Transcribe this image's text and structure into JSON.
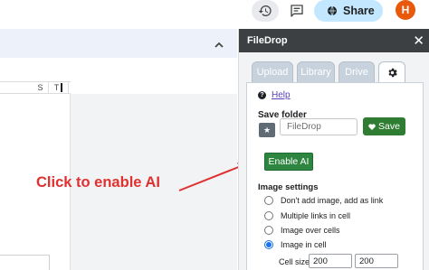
{
  "toolbar": {
    "history_icon": "history-icon",
    "comment_icon": "comment-icon",
    "share_label": "Share",
    "share_icon": "globe-icon",
    "avatar_letter": "H"
  },
  "sheet": {
    "columns": [
      "S",
      "T"
    ]
  },
  "annotation": {
    "text": "Click to enable AI",
    "color": "#e03131"
  },
  "panel": {
    "title": "FileDrop",
    "tabs": [
      {
        "label": "Upload"
      },
      {
        "label": "Library"
      },
      {
        "label": "Drive"
      },
      {
        "label": "",
        "icon": "gear-icon"
      }
    ],
    "help_label": "Help",
    "save_folder_label": "Save folder",
    "folder_placeholder": "FileDrop",
    "save_label": "Save",
    "enable_ai_label": "Enable AI",
    "image_settings_label": "Image settings",
    "image_options": [
      {
        "label": "Don't add image, add as link",
        "checked": false
      },
      {
        "label": "Multiple links in cell",
        "checked": false
      },
      {
        "label": "Image over cells",
        "checked": false
      },
      {
        "label": "Image in cell",
        "checked": true
      }
    ],
    "cell_size_label": "Cell size:",
    "cell_width": "200",
    "cell_height": "200"
  },
  "colors": {
    "panel_header": "#3c4043",
    "save_button": "#2e7d32",
    "share_button": "#c2e7ff",
    "avatar": "#e8590c"
  }
}
